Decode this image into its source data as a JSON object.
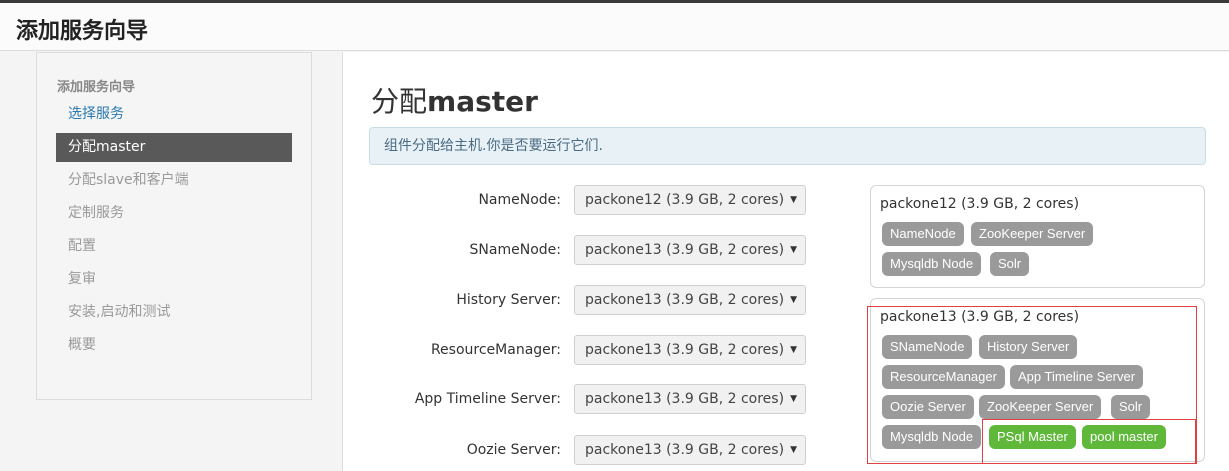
{
  "window": {
    "title": "添加服务向导"
  },
  "sidebar": {
    "header": "添加服务向导",
    "items": [
      {
        "label": "选择服务",
        "state": "link"
      },
      {
        "label": "分配master",
        "state": "active"
      },
      {
        "label": "分配slave和客户端",
        "state": "disabled"
      },
      {
        "label": "定制服务",
        "state": "disabled"
      },
      {
        "label": "配置",
        "state": "disabled"
      },
      {
        "label": "复审",
        "state": "disabled"
      },
      {
        "label": "安装,启动和测试",
        "state": "disabled"
      },
      {
        "label": "概要",
        "state": "disabled"
      }
    ]
  },
  "main": {
    "title_prefix": "分配",
    "title_bold": "master",
    "alert": "组件分配给主机.你是否要运行它们."
  },
  "assignments": [
    {
      "label": "NameNode:",
      "value": "packone12 (3.9 GB, 2 cores)"
    },
    {
      "label": "SNameNode:",
      "value": "packone13 (3.9 GB, 2 cores)"
    },
    {
      "label": "History Server:",
      "value": "packone13 (3.9 GB, 2 cores)"
    },
    {
      "label": "ResourceManager:",
      "value": "packone13 (3.9 GB, 2 cores)"
    },
    {
      "label": "App Timeline Server:",
      "value": "packone13 (3.9 GB, 2 cores)"
    },
    {
      "label": "Oozie Server:",
      "value": "packone13 (3.9 GB, 2 cores)"
    }
  ],
  "hosts": [
    {
      "name": "packone12 (3.9 GB, 2 cores)",
      "components": [
        "NameNode",
        "ZooKeeper Server",
        "Mysqldb Node",
        "Solr"
      ]
    },
    {
      "name": "packone13 (3.9 GB, 2 cores)",
      "components": [
        "SNameNode",
        "History Server",
        "ResourceManager",
        "App Timeline Server",
        "Oozie Server",
        "ZooKeeper Server",
        "Solr",
        "Mysqldb Node",
        "PSql Master",
        "pool master"
      ]
    }
  ],
  "colors": {
    "badge_gray": "#9a9a9a",
    "badge_new": "#5fb83a",
    "highlight": "#e04040"
  }
}
